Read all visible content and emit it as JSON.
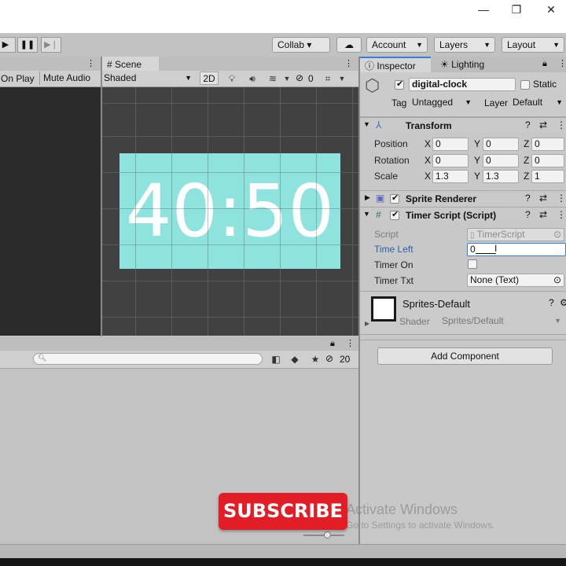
{
  "window": {
    "minimize_glyph": "—",
    "maximize_glyph": "❐",
    "close_glyph": "✕"
  },
  "toolbar": {
    "collab_label": "Collab ▾",
    "account_label": "Account",
    "layers_label": "Layers",
    "layout_label": "Layout"
  },
  "game_view": {
    "on_play_label": "On Play",
    "mute_audio_label": "Mute Audio"
  },
  "scene": {
    "tab_label": "Scene",
    "shading_mode": "Shaded",
    "mode_2d_label": "2D",
    "hidden_count": "0",
    "clock_text": "40:50",
    "clock_bg_color": "#8fe3df"
  },
  "project": {
    "hidden_count": "20"
  },
  "inspector": {
    "tab_label": "Inspector",
    "lighting_tab_label": "Lighting",
    "object_name": "digital-clock",
    "static_label": "Static",
    "tag_label": "Tag",
    "tag_value": "Untagged",
    "layer_label": "Layer",
    "layer_value": "Default",
    "transform": {
      "title": "Transform",
      "position_label": "Position",
      "rotation_label": "Rotation",
      "scale_label": "Scale",
      "x_label": "X",
      "y_label": "Y",
      "z_label": "Z",
      "position": [
        "0",
        "0",
        "0"
      ],
      "rotation": [
        "0",
        "0",
        "0"
      ],
      "scale": [
        "1.3",
        "1.3",
        "1"
      ]
    },
    "sprite_renderer_title": "Sprite Renderer",
    "timer_script": {
      "title": "Timer Script (Script)",
      "script_label": "Script",
      "script_value": "TimerScript",
      "time_left_label": "Time Left",
      "time_left_value": "0",
      "timer_on_label": "Timer On",
      "timer_txt_label": "Timer Txt",
      "timer_txt_value": "None (Text)"
    },
    "material": {
      "name": "Sprites-Default",
      "shader_label": "Shader",
      "shader_value": "Sprites/Default"
    },
    "add_component_label": "Add Component"
  },
  "overlay": {
    "subscribe_label": "SUBSCRIBE",
    "watermark_line1": "Activate Windows",
    "watermark_line2": "Go to Settings to activate Windows."
  }
}
